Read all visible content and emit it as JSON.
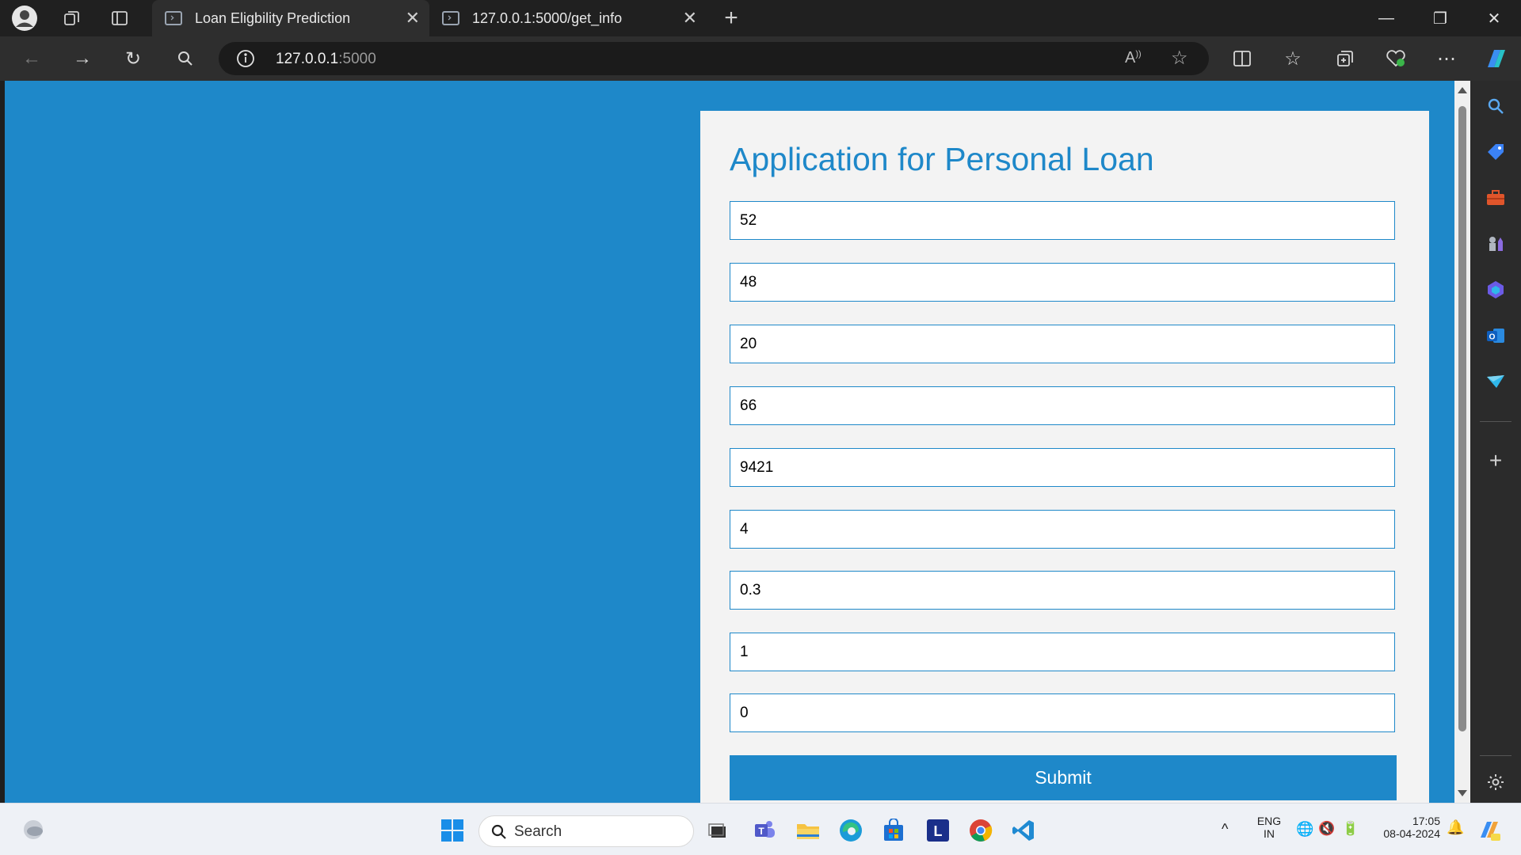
{
  "browser": {
    "tabs": [
      {
        "title": "Loan Eligbility Prediction",
        "active": true
      },
      {
        "title": "127.0.0.1:5000/get_info",
        "active": false
      }
    ],
    "url_host": "127.0.0.1",
    "url_port": ":5000"
  },
  "form": {
    "title": "Application for Personal Loan",
    "fields": [
      "52",
      "48",
      "20",
      "66",
      "9421",
      "4",
      "0.3",
      "1",
      "0"
    ],
    "submit_label": "Submit"
  },
  "taskbar": {
    "search_label": "Search",
    "lang_top": "ENG",
    "lang_bottom": "IN",
    "time": "17:05",
    "date": "08-04-2024"
  },
  "colors": {
    "accent": "#1e88c9",
    "card_bg": "#f3f3f3"
  }
}
